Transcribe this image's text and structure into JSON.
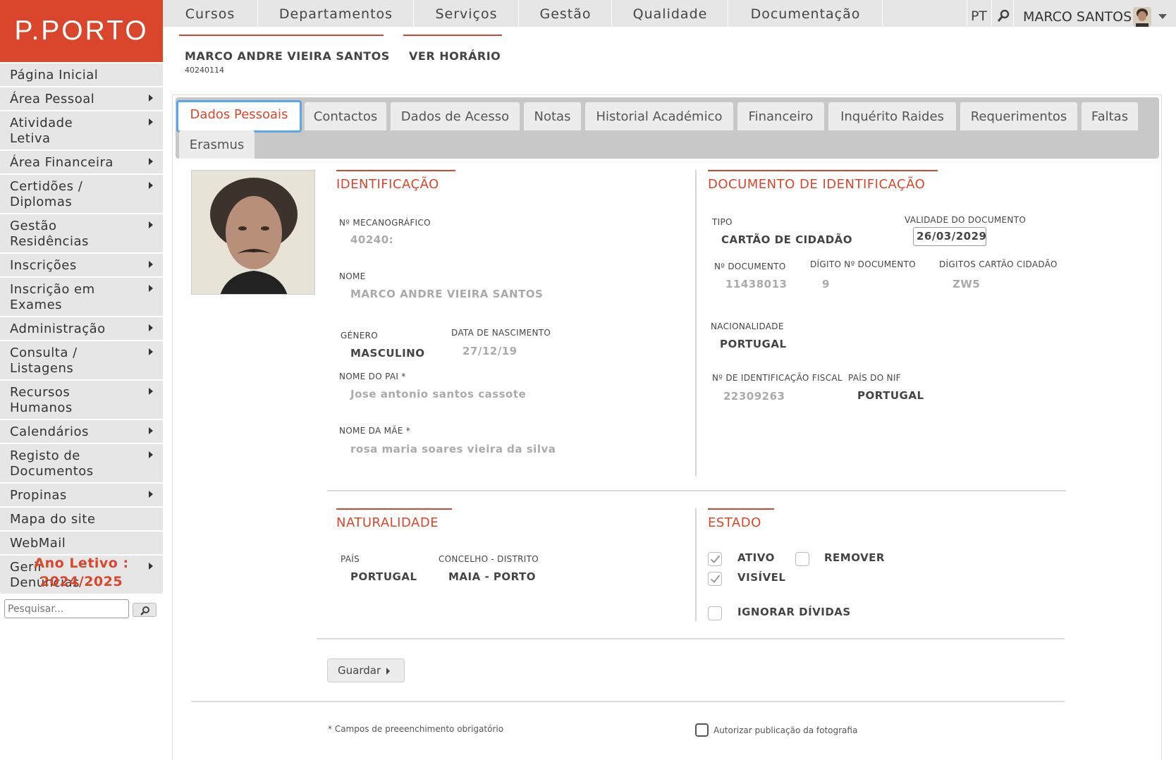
{
  "logo": {
    "text": "P.PORTO"
  },
  "topnav": {
    "items": [
      "Cursos",
      "Departamentos",
      "Serviços",
      "Gestão",
      "Qualidade",
      "Documentação"
    ],
    "lang": "PT",
    "user": "MARCO SANTOS"
  },
  "sidebar": {
    "items": [
      {
        "label": "Página Inicial",
        "arrow": false
      },
      {
        "label": "Área Pessoal",
        "arrow": true
      },
      {
        "label": "Atividade Letiva",
        "arrow": true
      },
      {
        "label": "Área Financeira",
        "arrow": true
      },
      {
        "label": "Certidões / Diplomas",
        "arrow": true
      },
      {
        "label": "Gestão Residências",
        "arrow": true
      },
      {
        "label": "Inscrições",
        "arrow": true
      },
      {
        "label": "Inscrição em Exames",
        "arrow": true
      },
      {
        "label": "Administração",
        "arrow": true
      },
      {
        "label": "Consulta / Listagens",
        "arrow": true
      },
      {
        "label": "Recursos Humanos",
        "arrow": true
      },
      {
        "label": "Calendários",
        "arrow": true
      },
      {
        "label": "Registo de Documentos",
        "arrow": true
      },
      {
        "label": "Propinas",
        "arrow": true
      },
      {
        "label": "Mapa do site",
        "arrow": false
      },
      {
        "label": "WebMail",
        "arrow": false
      },
      {
        "label": "Gerir Denúncias",
        "arrow": true
      }
    ],
    "ano_letivo_line1": "Ano Letivo :",
    "ano_letivo_line2": "2024/2025",
    "search_placeholder": "Pesquisar..."
  },
  "header": {
    "name": "MARCO ANDRE VIEIRA SANTOS",
    "number": "40240114",
    "ver_horario": "VER HORÁRIO"
  },
  "tabs": [
    "Dados Pessoais",
    "Contactos",
    "Dados de Acesso",
    "Notas",
    "Historial Académico",
    "Financeiro",
    "Inquérito Raides",
    "Requerimentos",
    "Faltas",
    "Erasmus"
  ],
  "identificacao": {
    "title": "IDENTIFICAÇÃO",
    "mec_label": "Nº MECANOGRÁFICO",
    "mec_value": "40240:",
    "nome_label": "NOME",
    "nome_value": "MARCO ANDRE VIEIRA SANTOS",
    "genero_label": "GÉNERO",
    "genero_value": "MASCULINO",
    "nasc_label": "DATA DE NASCIMENTO",
    "nasc_value": "27/12/19",
    "pai_label": "NOME DO PAI *",
    "pai_value": "Jose antonio santos cassote",
    "mae_label": "NOME DA MÃE *",
    "mae_value": "rosa maria soares vieira da silva"
  },
  "documento": {
    "title": "DOCUMENTO DE IDENTIFICAÇÃO",
    "tipo_label": "TIPO",
    "tipo_value": "CARTÃO DE CIDADÃO",
    "validade_label": "VALIDADE DO DOCUMENTO",
    "validade_value": "26/03/2029",
    "num_label": "Nº DOCUMENTO",
    "num_value": "11438013",
    "digito_label": "DÍGITO Nº DOCUMENTO",
    "digito_value": "9",
    "digitos_cc_label": "DÍGITOS CARTÃO CIDADÃO",
    "digitos_cc_value": "ZW5",
    "nacionalidade_label": "NACIONALIDADE",
    "nacionalidade_value": "PORTUGAL",
    "nif_label": "Nº DE IDENTIFICAÇÃO FISCAL",
    "nif_value": "22309263",
    "pais_nif_label": "PAÍS DO NIF",
    "pais_nif_value": "PORTUGAL"
  },
  "naturalidade": {
    "title": "NATURALIDADE",
    "pais_label": "PAÍS",
    "pais_value": "PORTUGAL",
    "concelho_label": "CONCELHO - DISTRITO",
    "concelho_value": "MAIA - PORTO"
  },
  "estado": {
    "title": "ESTADO",
    "ativo": "ATIVO",
    "remover": "REMOVER",
    "visivel": "VISÍVEL",
    "ignorar": "IGNORAR DÍVIDAS"
  },
  "actions": {
    "guardar": "Guardar"
  },
  "footer": {
    "obrigatorio": "* Campos de preeenchimento obrigatório",
    "autorizar": "Autorizar publicação da fotografia"
  },
  "colors": {
    "brand": "#d9462b",
    "tab_focus": "#5aa7ec"
  }
}
